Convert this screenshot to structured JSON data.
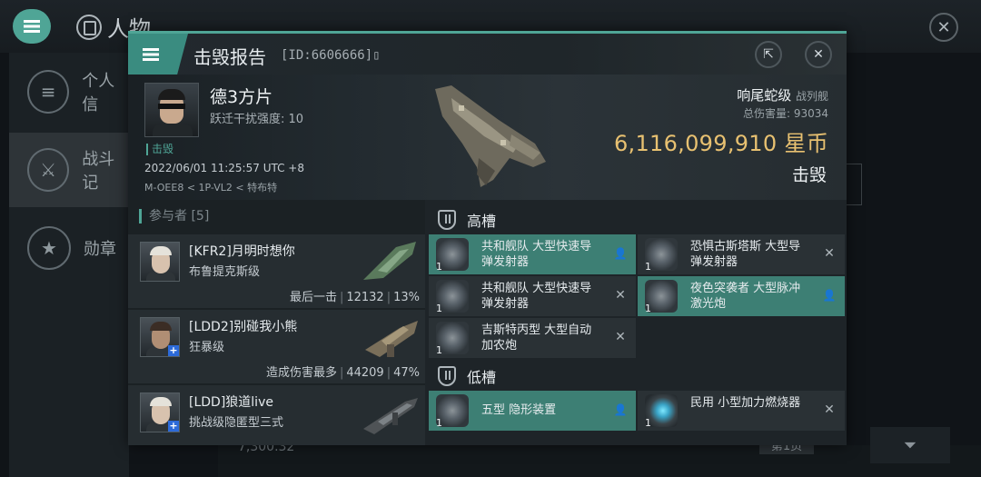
{
  "background": {
    "title": "人物",
    "sidebar": [
      {
        "label": "个人信"
      },
      {
        "label": "战斗记"
      },
      {
        "label": "勋章"
      }
    ],
    "bottom_value": "7,300.32",
    "page_label": "第1页"
  },
  "report": {
    "title": "击毁报告",
    "id_text": "[ID:6606666]",
    "victim": {
      "name": "德3方片",
      "warp_label": "跃迁干扰强度: 10",
      "tag": "击毁",
      "time": "2022/06/01 11:25:57 UTC +8",
      "location": "M-OEE8 < 1P-VL2 < 特布特"
    },
    "ship": {
      "name": "响尾蛇级",
      "class": "战列舰",
      "damage_label": "总伤害量: ",
      "damage_value": "93034",
      "value": "6,116,099,910",
      "currency": "星币",
      "status": "击毁"
    }
  },
  "participants": {
    "header": "参与者 [5]",
    "rows": [
      {
        "name": "[KFR2]月明时想你",
        "ship": "布鲁提克斯级",
        "stat_label": "最后一击",
        "damage": "12132",
        "percent": "13%"
      },
      {
        "name": "[LDD2]别碰我小熊",
        "ship": "狂暴级",
        "stat_label": "造成伤害最多",
        "damage": "44209",
        "percent": "47%"
      },
      {
        "name": "[LDD]狼道live",
        "ship": "挑战级隐匿型三式",
        "stat_label": "",
        "damage": "",
        "percent": ""
      }
    ]
  },
  "slots": {
    "high": {
      "label": "高槽",
      "modules": [
        {
          "name": "共和舰队 大型快速导弹发射器",
          "qty": "1",
          "action": "user",
          "highlight": true
        },
        {
          "name": "恐惧古斯塔斯 大型导弹发射器",
          "qty": "1",
          "action": "close",
          "highlight": false
        },
        {
          "name": "共和舰队 大型快速导弹发射器",
          "qty": "1",
          "action": "close",
          "highlight": false
        },
        {
          "name": "夜色突袭者 大型脉冲激光炮",
          "qty": "1",
          "action": "user",
          "highlight": true
        },
        {
          "name": "吉斯特丙型 大型自动加农炮",
          "qty": "1",
          "action": "close",
          "highlight": false
        }
      ]
    },
    "low": {
      "label": "低槽",
      "modules": [
        {
          "name": "五型 隐形装置",
          "qty": "1",
          "action": "user",
          "highlight": true
        },
        {
          "name": "民用 小型加力燃烧器",
          "qty": "1",
          "action": "close",
          "highlight": false
        }
      ]
    }
  },
  "icons": {
    "menu": "menu-icon",
    "share": "share-icon",
    "close": "close-icon",
    "copy": "copy-icon",
    "user": "user-icon",
    "filter": "filter-icon"
  },
  "colors": {
    "accent": "#4fa596",
    "isk": "#e8c171",
    "highlight": "#3d7f74"
  }
}
